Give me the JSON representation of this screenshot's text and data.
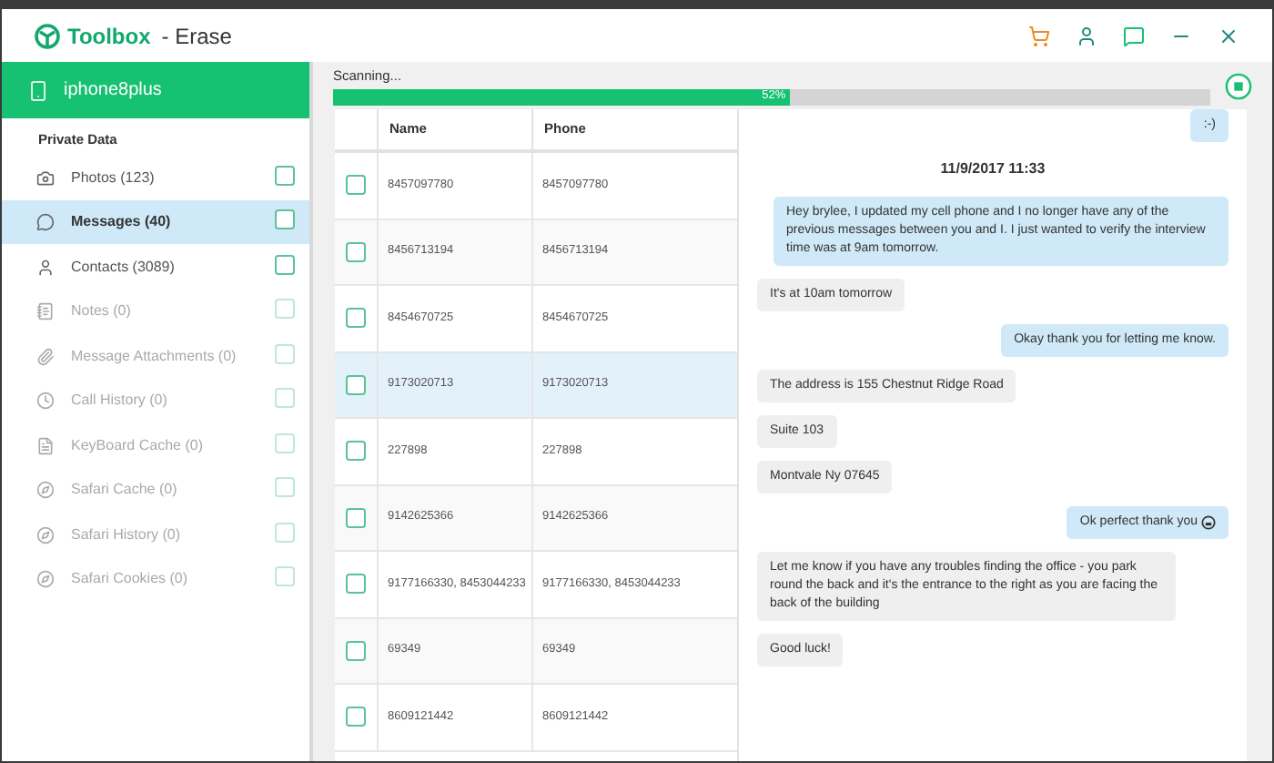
{
  "window": {
    "app_name": "Toolbox",
    "title": "- Erase"
  },
  "device": {
    "name": "iphone8plus"
  },
  "sidebar": {
    "heading": "Private Data",
    "items": [
      {
        "label": "Photos (123)",
        "selected": false,
        "disabled": false,
        "checked": false
      },
      {
        "label": "Messages (40)",
        "selected": true,
        "disabled": false,
        "checked": false
      },
      {
        "label": "Contacts (3089)",
        "selected": false,
        "disabled": false,
        "checked": false
      },
      {
        "label": "Notes (0)",
        "selected": false,
        "disabled": true,
        "checked": false
      },
      {
        "label": "Message Attachments (0)",
        "selected": false,
        "disabled": true,
        "checked": false
      },
      {
        "label": "Call History (0)",
        "selected": false,
        "disabled": true,
        "checked": false
      },
      {
        "label": "KeyBoard Cache (0)",
        "selected": false,
        "disabled": true,
        "checked": false
      },
      {
        "label": "Safari Cache (0)",
        "selected": false,
        "disabled": true,
        "checked": false
      },
      {
        "label": "Safari History (0)",
        "selected": false,
        "disabled": true,
        "checked": false
      },
      {
        "label": "Safari Cookies (0)",
        "selected": false,
        "disabled": true,
        "checked": false
      }
    ]
  },
  "scan": {
    "label": "Scanning...",
    "level": 0.52,
    "reading": "52%"
  },
  "table": {
    "columns": [
      "Name",
      "Phone"
    ],
    "rows": [
      {
        "name": "8457097780",
        "phone": "8457097780",
        "selected": false,
        "checked": false
      },
      {
        "name": "8456713194",
        "phone": "8456713194",
        "selected": false,
        "checked": false
      },
      {
        "name": "8454670725",
        "phone": "8454670725",
        "selected": false,
        "checked": false
      },
      {
        "name": "9173020713",
        "phone": "9173020713",
        "selected": true,
        "checked": false
      },
      {
        "name": "227898",
        "phone": "227898",
        "selected": false,
        "checked": false
      },
      {
        "name": "9142625366",
        "phone": "9142625366",
        "selected": false,
        "checked": false
      },
      {
        "name": "9177166330, 8453044233",
        "phone": "9177166330, 8453044233",
        "selected": false,
        "checked": false
      },
      {
        "name": "69349",
        "phone": "69349",
        "selected": false,
        "checked": false
      },
      {
        "name": "8609121442",
        "phone": "8609121442",
        "selected": false,
        "checked": false
      }
    ]
  },
  "messages": [
    {
      "kind": "sent",
      "text": ":-)"
    },
    {
      "kind": "date",
      "text": "11/9/2017 11:33"
    },
    {
      "kind": "sent",
      "text": "Hey brylee, I updated my cell phone and I no longer have any of the previous messages between you and I. I just wanted to verify the interview time was at 9am tomorrow."
    },
    {
      "kind": "received",
      "text": "It's at 10am tomorrow"
    },
    {
      "kind": "sent",
      "text": "Okay thank you for letting me know."
    },
    {
      "kind": "received",
      "text": "The address is 155 Chestnut Ridge Road"
    },
    {
      "kind": "received",
      "text": "Suite 103"
    },
    {
      "kind": "received",
      "text": "Montvale Ny 07645"
    },
    {
      "kind": "sent",
      "text": "Ok perfect thank you",
      "emoji": true
    },
    {
      "kind": "received",
      "text": "Let me know if you have any troubles finding the office - you park round the back and it's the entrance to the right as you are facing the back of the building"
    },
    {
      "kind": "received",
      "text": "Good luck!"
    }
  ]
}
